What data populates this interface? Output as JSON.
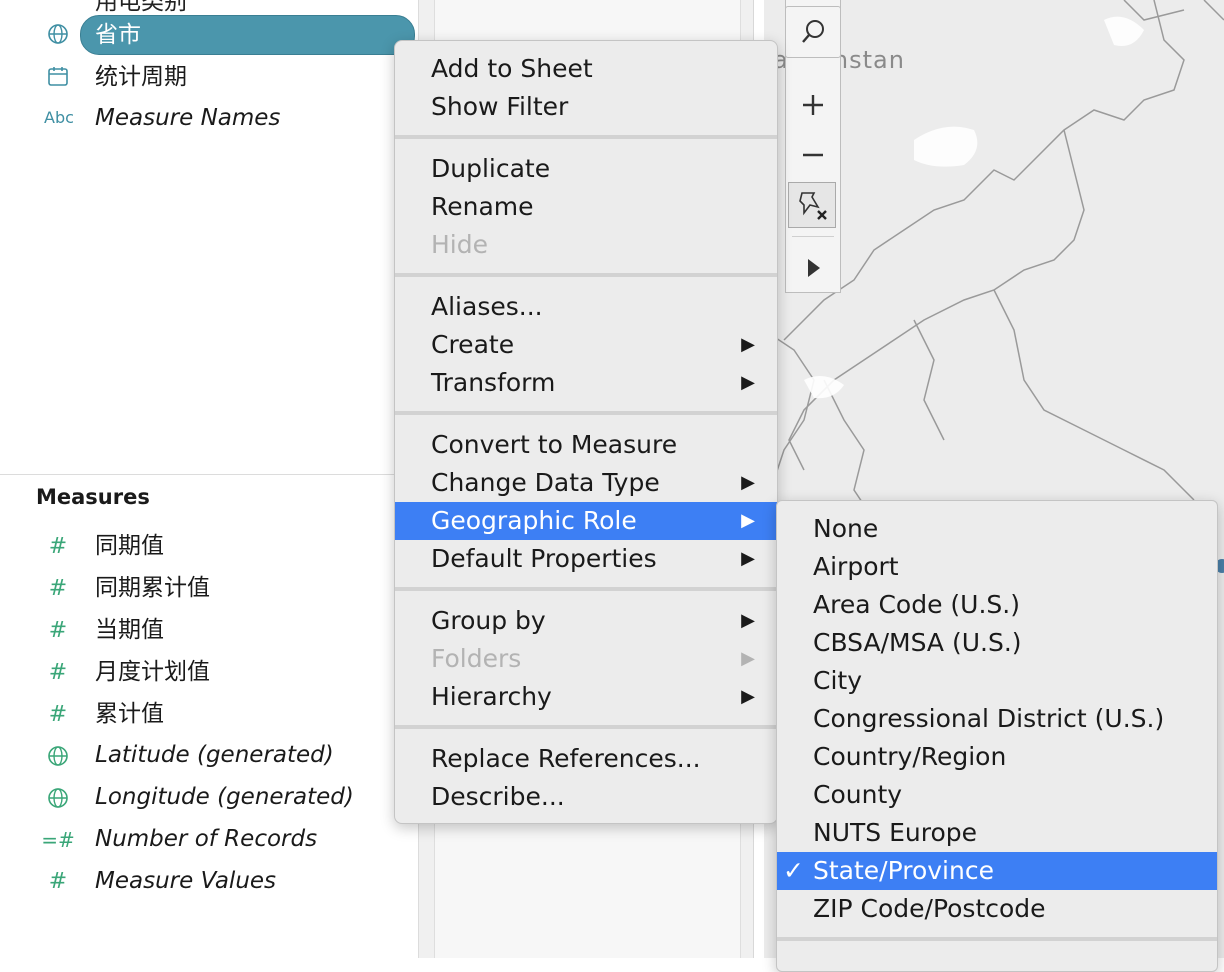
{
  "data_pane": {
    "truncated_top_label": "用电类别",
    "dimensions": [
      {
        "icon": "globe-icon",
        "label": "省市",
        "selected": true,
        "italic": false
      },
      {
        "icon": "calendar-icon",
        "label": "统计周期",
        "selected": false,
        "italic": false
      },
      {
        "icon": "abc-icon",
        "icon_text": "Abc",
        "label": "Measure Names",
        "selected": false,
        "italic": true
      }
    ],
    "measures_header": "Measures",
    "measures": [
      {
        "icon": "hash-icon",
        "label": "同期值",
        "italic": false
      },
      {
        "icon": "hash-icon",
        "label": "同期累计值",
        "italic": false
      },
      {
        "icon": "hash-icon",
        "label": "当期值",
        "italic": false
      },
      {
        "icon": "hash-icon",
        "label": "月度计划值",
        "italic": false
      },
      {
        "icon": "hash-icon",
        "label": "累计值",
        "italic": false
      },
      {
        "icon": "globe-icon",
        "label": "Latitude (generated)",
        "italic": true
      },
      {
        "icon": "globe-icon",
        "label": "Longitude (generated)",
        "italic": true
      },
      {
        "icon": "calc-hash-icon",
        "label": "Number of Records",
        "italic": true
      },
      {
        "icon": "hash-icon",
        "label": "Measure Values",
        "italic": true
      }
    ]
  },
  "map": {
    "place_label": "azakhstan",
    "tools": [
      "search-icon",
      "zoom-in-icon",
      "zoom-out-icon",
      "unpin-icon",
      "expand-arrow-icon"
    ]
  },
  "context_menu": {
    "groups": [
      [
        {
          "label": "Add to Sheet"
        },
        {
          "label": "Show Filter"
        }
      ],
      [
        {
          "label": "Duplicate"
        },
        {
          "label": "Rename"
        },
        {
          "label": "Hide",
          "disabled": true
        }
      ],
      [
        {
          "label": "Aliases..."
        },
        {
          "label": "Create",
          "submenu": true
        },
        {
          "label": "Transform",
          "submenu": true
        }
      ],
      [
        {
          "label": "Convert to Measure"
        },
        {
          "label": "Change Data Type",
          "submenu": true
        },
        {
          "label": "Geographic Role",
          "submenu": true,
          "highlighted": true
        },
        {
          "label": "Default Properties",
          "submenu": true
        }
      ],
      [
        {
          "label": "Group by",
          "submenu": true
        },
        {
          "label": "Folders",
          "submenu": true,
          "disabled": true
        },
        {
          "label": "Hierarchy",
          "submenu": true
        }
      ],
      [
        {
          "label": "Replace References..."
        },
        {
          "label": "Describe..."
        }
      ]
    ]
  },
  "geo_submenu": {
    "check_mark": "✓",
    "items": [
      {
        "label": "None"
      },
      {
        "label": "Airport"
      },
      {
        "label": "Area Code (U.S.)"
      },
      {
        "label": "CBSA/MSA (U.S.)"
      },
      {
        "label": "City"
      },
      {
        "label": "Congressional District (U.S.)"
      },
      {
        "label": "Country/Region"
      },
      {
        "label": "County"
      },
      {
        "label": "NUTS Europe"
      },
      {
        "label": "State/Province",
        "checked": true
      },
      {
        "label": "ZIP Code/Postcode"
      }
    ]
  },
  "colors": {
    "pill": "#4b96ac",
    "highlight": "#3d7ff4",
    "dimension_icon": "#3f8fa3",
    "measure_icon": "#3aa678",
    "disabled_text": "#b3b3b3"
  }
}
